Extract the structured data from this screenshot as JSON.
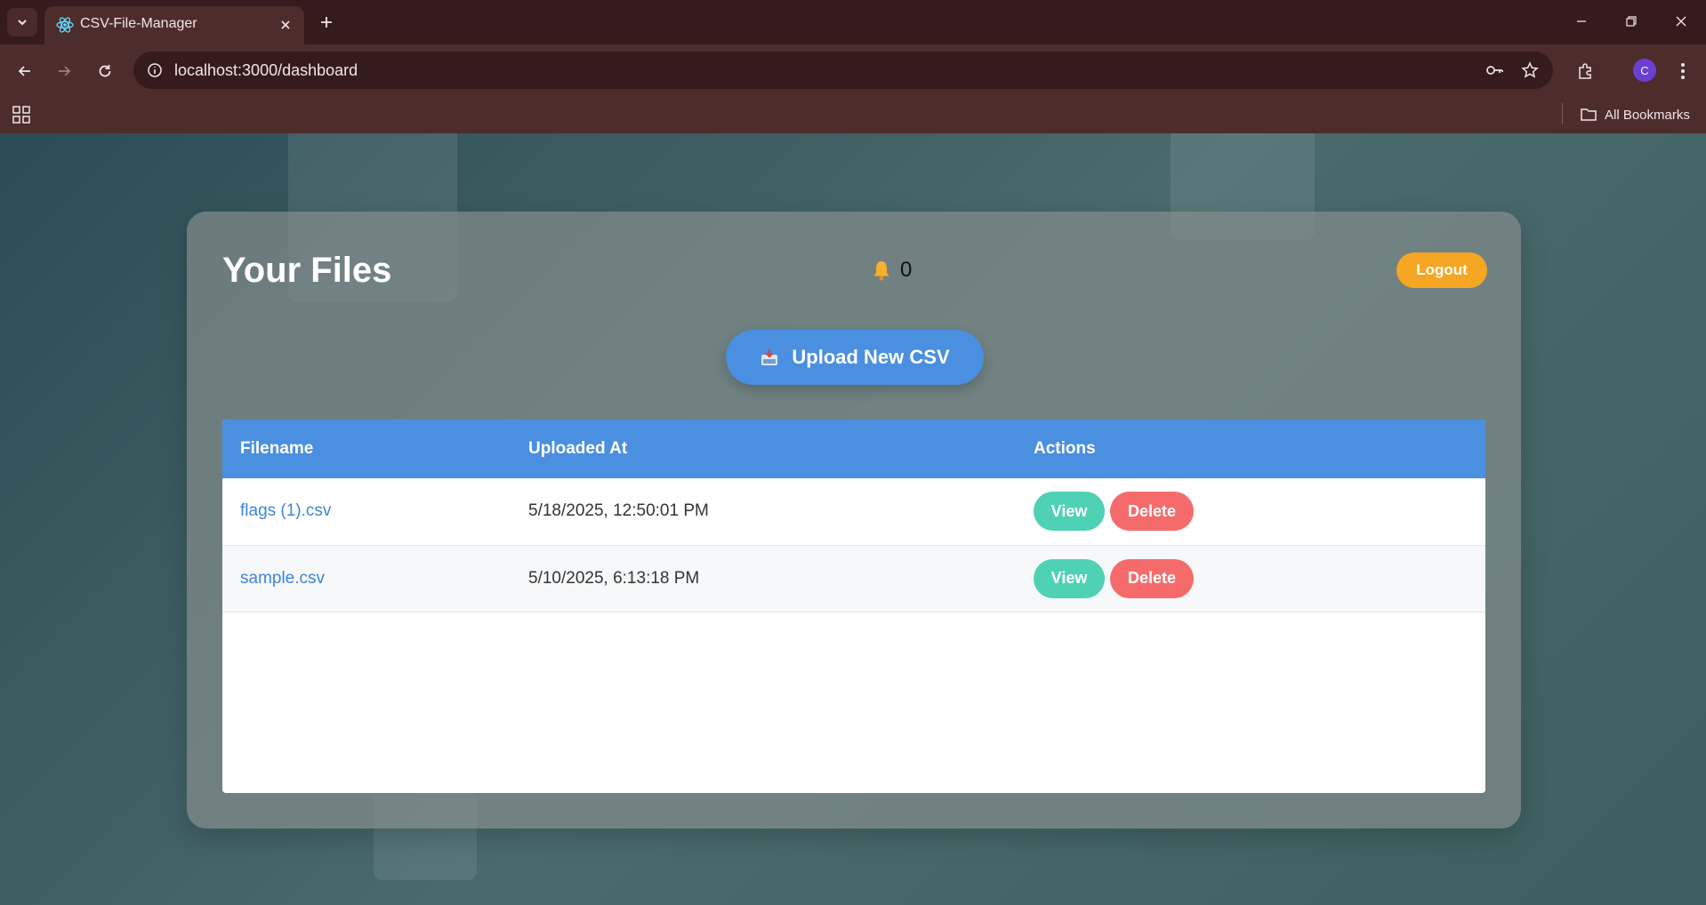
{
  "browser": {
    "tab_title": "CSV-File-Manager",
    "url": "localhost:3000/dashboard",
    "profile_initial": "C",
    "bookmarks_label": "All Bookmarks"
  },
  "dashboard": {
    "title": "Your Files",
    "notification_count": "0",
    "logout_label": "Logout",
    "upload_label": "Upload New CSV"
  },
  "table": {
    "headers": [
      "Filename",
      "Uploaded At",
      "Actions"
    ],
    "rows": [
      {
        "filename": "flags (1).csv",
        "uploaded_at": "5/18/2025, 12:50:01 PM",
        "view_label": "View",
        "delete_label": "Delete"
      },
      {
        "filename": "sample.csv",
        "uploaded_at": "5/10/2025, 6:13:18 PM",
        "view_label": "View",
        "delete_label": "Delete"
      }
    ]
  },
  "colors": {
    "primary": "#4a8fe0",
    "logout": "#f5a623",
    "view": "#4fd1b4",
    "delete": "#f56b6b"
  }
}
